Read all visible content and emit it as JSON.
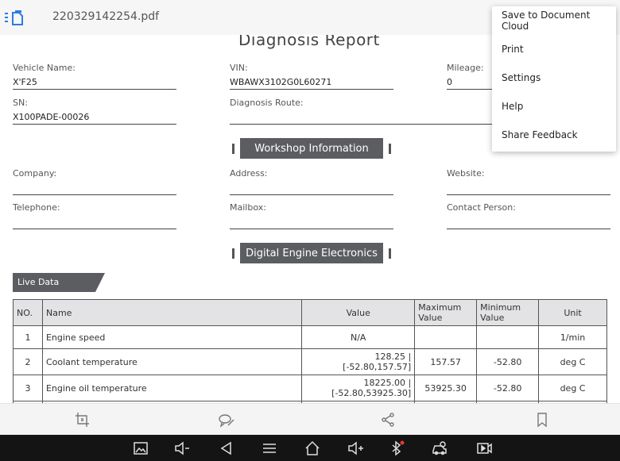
{
  "header": {
    "filename": "220329142254.pdf"
  },
  "report": {
    "title": "Diagnosis Report",
    "vehicle_name_label": "Vehicle Name:",
    "vehicle_name": "X'F25",
    "vin_label": "VIN:",
    "vin": "WBAWX3102G0L60271",
    "mileage_label": "Mileage:",
    "mileage": "0",
    "sn_label": "SN:",
    "sn": "X100PADE-00026",
    "route_label": "Diagnosis Route:",
    "route": "",
    "workshop_title": "Workshop Information",
    "company_label": "Company:",
    "address_label": "Address:",
    "website_label": "Website:",
    "telephone_label": "Telephone:",
    "mailbox_label": "Mailbox:",
    "contact_label": "Contact Person:",
    "system_title": "Digital Engine Electronics",
    "live_data_label": "Live Data"
  },
  "table": {
    "headers": {
      "no": "NO.",
      "name": "Name",
      "value": "Value",
      "max": "Maximum Value",
      "min": "Minimum Value",
      "unit": "Unit"
    },
    "rows": [
      {
        "no": "1",
        "name": "Engine speed",
        "value": "N/A",
        "max": "",
        "min": "",
        "unit": "1/min"
      },
      {
        "no": "2",
        "name": "Coolant temperature",
        "value": "128.25 | [-52.80,157.57]",
        "max": "157.57",
        "min": "-52.80",
        "unit": "deg C"
      },
      {
        "no": "3",
        "name": "Engine oil temperature",
        "value": "18225.00 | [-52.80,53925.30]",
        "max": "53925.30",
        "min": "-52.80",
        "unit": "deg C"
      }
    ]
  },
  "menu": {
    "items": [
      "Save to Document Cloud",
      "Print",
      "Settings",
      "Help",
      "Share Feedback"
    ]
  },
  "bottom_toolbar": {
    "icons": [
      "crop-icon",
      "edit-icon",
      "share-icon",
      "bookmark-icon"
    ]
  },
  "nav_bar": {
    "icons": [
      "screenshot-icon",
      "volume-down-icon",
      "back-icon",
      "menu-icon",
      "home-icon",
      "volume-up-icon",
      "bluetooth-icon",
      "vehicle-icon",
      "record-icon"
    ]
  },
  "colors": {
    "banner": "#5b5d61",
    "table_header": "#e3e3e6",
    "accent_blue": "#2a7de1",
    "nav_bg": "#141414"
  }
}
